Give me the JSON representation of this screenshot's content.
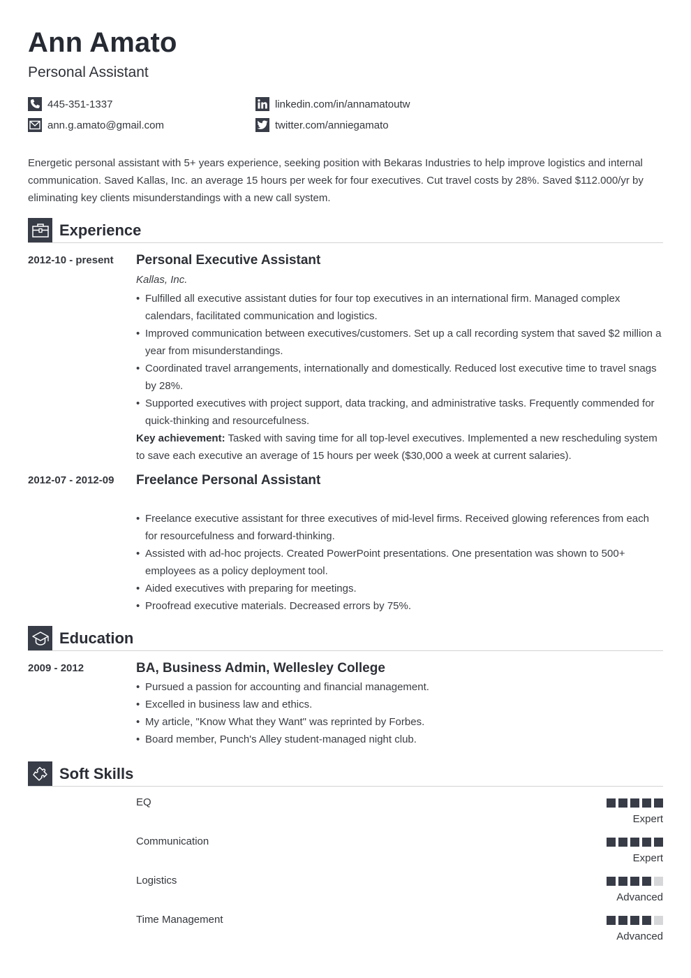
{
  "header": {
    "name": "Ann Amato",
    "title": "Personal Assistant"
  },
  "contacts": {
    "phone": {
      "icon": "phone-icon",
      "text": "445-351-1337"
    },
    "email": {
      "icon": "envelope-icon",
      "text": "ann.g.amato@gmail.com"
    },
    "linkedin": {
      "icon": "linkedin-icon",
      "text": "linkedin.com/in/annamatoutw"
    },
    "twitter": {
      "icon": "twitter-icon",
      "text": "twitter.com/anniegamato"
    }
  },
  "summary": "Energetic personal assistant with 5+ years experience, seeking position with Bekaras Industries to help improve logistics and internal communication. Saved Kallas, Inc. an average 15 hours per week for four executives. Cut travel costs by 28%. Saved $112.000/yr by eliminating key clients misunderstandings with a new call system.",
  "experience": {
    "heading": "Experience",
    "icon": "briefcase-icon",
    "entries": [
      {
        "date": "2012-10 - present",
        "role": "Personal Executive Assistant",
        "company": "Kallas, Inc.",
        "bullets": [
          "Fulfilled all executive assistant duties for four top executives in an international firm. Managed complex calendars, facilitated communication and logistics.",
          "Improved communication between executives/customers. Set up a call recording system that saved $2 million a year from misunderstandings.",
          "Coordinated travel arrangements, internationally and domestically. Reduced lost executive time to travel snags by 28%.",
          "Supported executives with project support, data tracking, and administrative tasks. Frequently commended for quick-thinking and resourcefulness."
        ],
        "achievement_label": "Key achievement:",
        "achievement_text": " Tasked with saving time for all top-level executives. Implemented a new rescheduling system to save each executive an average of 15 hours per week ($30,000 a week at current salaries)."
      },
      {
        "date": "2012-07 - 2012-09",
        "role": "Freelance Personal Assistant",
        "company": "",
        "bullets": [
          "Freelance executive assistant for three executives of mid-level firms. Received glowing references from each for resourcefulness and forward-thinking.",
          "Assisted with ad-hoc projects. Created PowerPoint presentations. One presentation was shown to 500+ employees as a policy deployment tool.",
          "Aided executives with preparing for meetings.",
          "Proofread executive materials. Decreased errors by 75%."
        ]
      }
    ]
  },
  "education": {
    "heading": "Education",
    "icon": "graduation-cap-icon",
    "entries": [
      {
        "date": "2009 - 2012",
        "degree": "BA, Business Admin, Wellesley College",
        "bullets": [
          "Pursued a passion for accounting and financial management.",
          "Excelled in business law and ethics.",
          "My article, \"Know What they Want\" was reprinted by Forbes.",
          "Board member, Punch's Alley student-managed night club."
        ]
      }
    ]
  },
  "soft_skills": {
    "heading": "Soft Skills",
    "icon": "puzzle-piece-icon",
    "max_level": 5,
    "items": [
      {
        "name": "EQ",
        "level": 5,
        "label": "Expert"
      },
      {
        "name": "Communication",
        "level": 5,
        "label": "Expert"
      },
      {
        "name": "Logistics",
        "level": 4,
        "label": "Advanced"
      },
      {
        "name": "Time Management",
        "level": 4,
        "label": "Advanced"
      }
    ]
  },
  "colors": {
    "accent": "#373c47",
    "dot_off": "#d6d7d8",
    "text": "#2a2d33",
    "divider": "#d3d3d3"
  }
}
